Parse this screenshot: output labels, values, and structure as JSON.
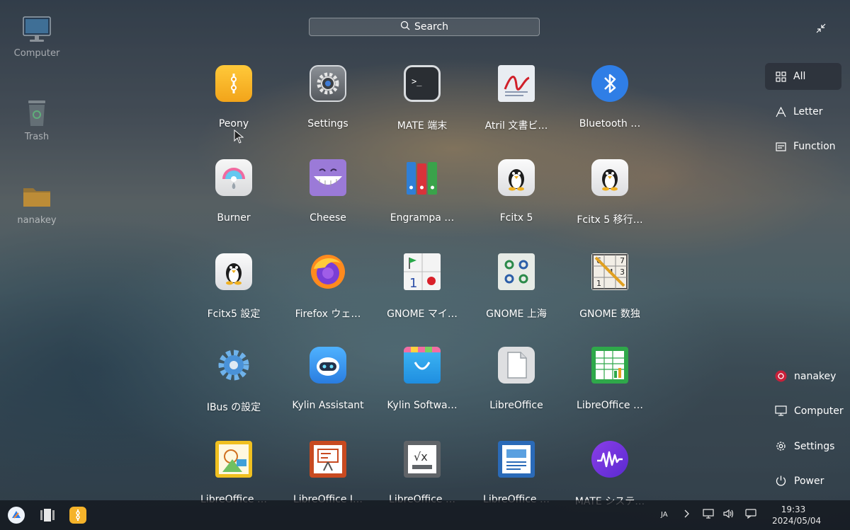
{
  "desktop": {
    "icons": [
      {
        "label": "Computer"
      },
      {
        "label": "Trash"
      },
      {
        "label": "nanakey"
      }
    ]
  },
  "search": {
    "placeholder": "Search"
  },
  "apps": [
    {
      "name": "Peony",
      "icon": "peony-icon"
    },
    {
      "name": "Settings",
      "icon": "settings-gear-icon"
    },
    {
      "name": "MATE 端末",
      "icon": "terminal-icon"
    },
    {
      "name": "Atril 文書ビ…",
      "icon": "atril-document-viewer-icon"
    },
    {
      "name": "Bluetooth …",
      "icon": "bluetooth-icon"
    },
    {
      "name": "Burner",
      "icon": "burner-disc-icon"
    },
    {
      "name": "Cheese",
      "icon": "cheese-icon"
    },
    {
      "name": "Engrampa …",
      "icon": "engrampa-archive-icon"
    },
    {
      "name": "Fcitx 5",
      "icon": "fcitx-penguin-icon"
    },
    {
      "name": "Fcitx 5 移行…",
      "icon": "fcitx-migrator-penguin-icon"
    },
    {
      "name": "Fcitx5 設定",
      "icon": "fcitx-config-penguin-icon"
    },
    {
      "name": "Firefox ウェ…",
      "icon": "firefox-icon"
    },
    {
      "name": "GNOME マイ…",
      "icon": "gnome-mines-icon"
    },
    {
      "name": "GNOME 上海",
      "icon": "gnome-mahjongg-icon"
    },
    {
      "name": "GNOME 数独",
      "icon": "gnome-sudoku-icon"
    },
    {
      "name": "IBus の設定",
      "icon": "ibus-gear-icon"
    },
    {
      "name": "Kylin Assistant",
      "icon": "kylin-assistant-robot-icon"
    },
    {
      "name": "Kylin Softwa…",
      "icon": "kylin-software-store-icon"
    },
    {
      "name": "LibreOffice",
      "icon": "libreoffice-icon"
    },
    {
      "name": "LibreOffice …",
      "icon": "libreoffice-calc-icon"
    },
    {
      "name": "LibreOffice …",
      "icon": "libreoffice-draw-icon"
    },
    {
      "name": "LibreOffice I…",
      "icon": "libreoffice-impress-icon"
    },
    {
      "name": "LibreOffice …",
      "icon": "libreoffice-math-icon"
    },
    {
      "name": "LibreOffice …",
      "icon": "libreoffice-writer-icon"
    },
    {
      "name": "MATE システ…",
      "icon": "mate-system-monitor-icon"
    }
  ],
  "categories": [
    {
      "label": "All",
      "icon": "grid-icon",
      "active": true
    },
    {
      "label": "Letter",
      "icon": "letter-a-icon",
      "active": false
    },
    {
      "label": "Function",
      "icon": "function-list-icon",
      "active": false
    }
  ],
  "system": [
    {
      "label": "nanakey",
      "icon": "user-avatar-icon"
    },
    {
      "label": "Computer",
      "icon": "monitor-icon"
    },
    {
      "label": "Settings",
      "icon": "settings-icon"
    },
    {
      "label": "Power",
      "icon": "power-icon"
    }
  ],
  "taskbar": {
    "input_method": "JA",
    "time": "19:33",
    "date": "2024/05/04"
  },
  "colors": {
    "accent": "#2b7de9",
    "panel_active": "#2c3038"
  }
}
